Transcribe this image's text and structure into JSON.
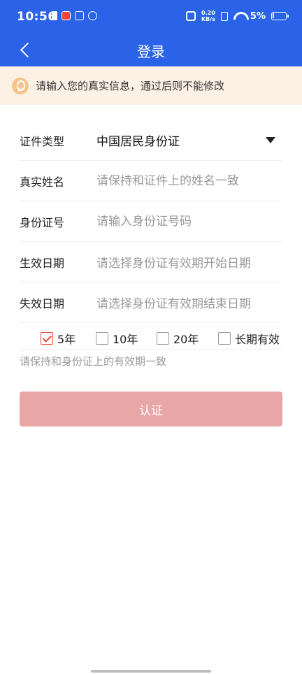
{
  "status_bar": {
    "time": "10:56",
    "net_speed_value": "0.20",
    "net_speed_unit": "KB/s",
    "battery_percent": "5%"
  },
  "header": {
    "title": "登录"
  },
  "notice": {
    "text": "请输入您的真实信息，通过后则不能修改"
  },
  "form": {
    "id_type_label": "证件类型",
    "id_type_value": "中国居民身份证",
    "name_label": "真实姓名",
    "name_placeholder": "请保持和证件上的姓名一致",
    "id_number_label": "身份证号",
    "id_number_placeholder": "请输入身份证号码",
    "start_date_label": "生效日期",
    "start_date_placeholder": "请选择身份证有效期开始日期",
    "end_date_label": "失效日期",
    "end_date_placeholder": "请选择身份证有效期结束日期"
  },
  "validity_options": [
    {
      "label": "5年",
      "checked": true
    },
    {
      "label": "10年",
      "checked": false
    },
    {
      "label": "20年",
      "checked": false
    },
    {
      "label": "长期有效",
      "checked": false
    }
  ],
  "hint": "请保持和身份证上的有效期一致",
  "submit_label": "认证",
  "colors": {
    "header_blue": "#2b63e8",
    "notice_bg": "#fdf1e6",
    "check_red": "#e8473a",
    "button_disabled": "#e8a6a6"
  }
}
